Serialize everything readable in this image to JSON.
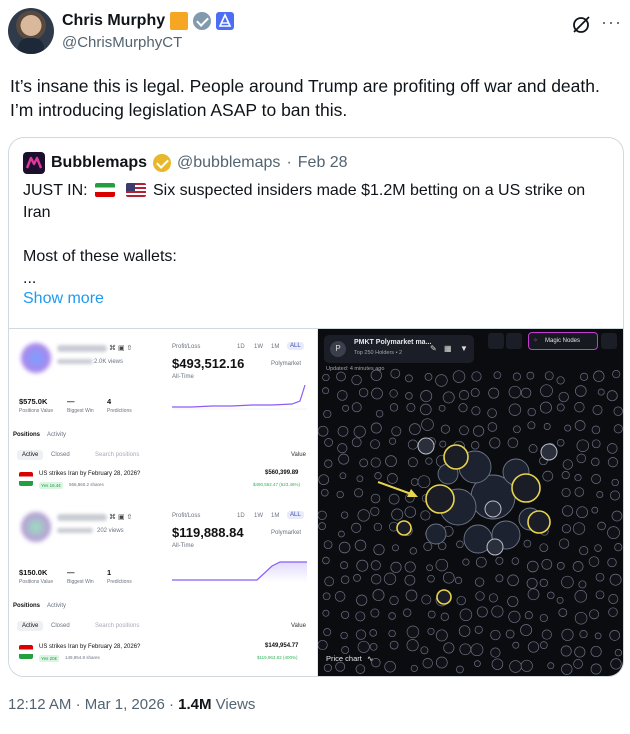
{
  "author": {
    "name": "Chris Murphy",
    "handle": "@ChrisMurphyCT"
  },
  "tweet": {
    "text": "It’s insane this is legal. People around Trump are profiting off war and death. I’m introducing legislation ASAP to ban this."
  },
  "quote": {
    "name": "Bubblemaps",
    "handle": "@bubblemaps",
    "separator": "·",
    "date": "Feb 28",
    "line1_prefix": "JUST IN:",
    "line1_rest": "Six suspected insiders made $1.2M betting on a US strike on Iran",
    "line2": "Most of these wallets:",
    "line3": "...",
    "show_more": "Show more"
  },
  "media": {
    "left": {
      "profiles": [
        {
          "views": "2.0K views",
          "pl_label": "Profit/Loss",
          "ranges": [
            "1D",
            "1W",
            "1M",
            "ALL"
          ],
          "amount": "$493,512.16",
          "all_time": "All-Time",
          "brand": "Polymarket",
          "positions_value": "$575.0K",
          "positions_value_label": "Positions Value",
          "biggest_win": "—",
          "biggest_win_label": "Biggest Win",
          "predictions": "4",
          "predictions_label": "Predictions",
          "tabs": [
            "Positions",
            "Activity"
          ],
          "filters": [
            "Active",
            "Closed"
          ],
          "search_placeholder": "Search positions",
          "sort": "Value",
          "market": "US strikes Iran by February 28, 2026?",
          "market_pill": "Yes 16.4¢",
          "market_shares": "566,860.2 shares",
          "market_value": "$560,399.89",
          "market_gain": "$490,562.47 (623.46%)"
        },
        {
          "views": "202 views",
          "pl_label": "Profit/Loss",
          "ranges": [
            "1D",
            "1W",
            "1M",
            "ALL"
          ],
          "amount": "$119,888.84",
          "all_time": "All-Time",
          "brand": "Polymarket",
          "positions_value": "$150.0K",
          "positions_value_label": "Positions Value",
          "biggest_win": "—",
          "biggest_win_label": "Biggest Win",
          "predictions": "1",
          "predictions_label": "Predictions",
          "tabs": [
            "Positions",
            "Activity"
          ],
          "filters": [
            "Active",
            "Closed"
          ],
          "search_placeholder": "Search positions",
          "sort": "Value",
          "market": "US strikes Iran by February 28, 2026?",
          "market_pill": "Yes 20¢",
          "market_shares": "149,954.8 shares",
          "market_value": "$149,954.77",
          "market_gain": "$119,963.82 (400%)"
        }
      ]
    },
    "right": {
      "title": "PMKT Polymarket ma...",
      "subtitle": "Top 250 Holders • 2",
      "updated": "Updated: 4 minutes ago",
      "magic_nodes": "Magic Nodes",
      "price_chart": "Price chart",
      "accent_yellow": "#e8d44d",
      "accent_magenta": "#c33bd0"
    }
  },
  "footer": {
    "time": "12:12 AM",
    "date": "Mar 1, 2026",
    "views_count": "1.4M",
    "views_label": "Views"
  }
}
